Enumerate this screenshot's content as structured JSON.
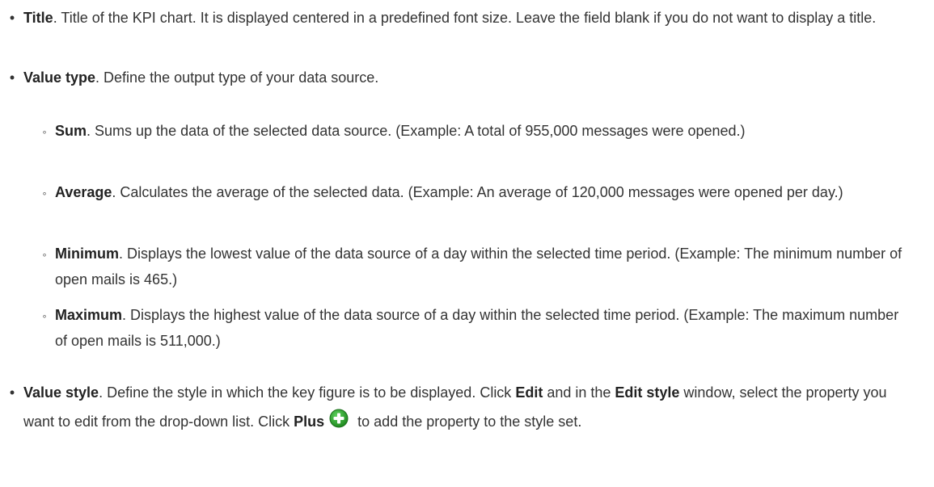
{
  "items": [
    {
      "term": "Title",
      "text": ". Title of the KPI chart. It is displayed centered in a predefined font size. Leave the field blank if you do not want to display a title."
    },
    {
      "term": "Value type",
      "text": ". Define the output type of your data source."
    }
  ],
  "sub_items": [
    {
      "term": "Sum",
      "text": ". Sums up the data of the selected data source. (Example: A total of 955,000 messages were opened.)"
    },
    {
      "term": "Average",
      "text": ". Calculates the average of the selected data. (Example: An average of 120,000 messages were opened per day.)"
    },
    {
      "term": "Minimum",
      "text": ". Displays the lowest value of the data source of a day within the selected time period. (Example: The minimum number of open mails is 465.)"
    },
    {
      "term": "Maximum",
      "text": ". Displays the highest value of the data source of a day within the selected time period. (Example: The maximum number of open mails is 511,000.)"
    }
  ],
  "value_style": {
    "term": "Value style",
    "text_1": ". Define the style in which the key figure is to be displayed. Click ",
    "edit": "Edit",
    "text_2": " and in the ",
    "edit_style": "Edit style",
    "text_3": " window, select the property you want to edit from the drop-down list. Click ",
    "plus": "Plus",
    "text_4": " to add the property to the style set."
  },
  "icons": {
    "plus": "plus-circle-icon",
    "plus_color": "#2e9e2e"
  }
}
